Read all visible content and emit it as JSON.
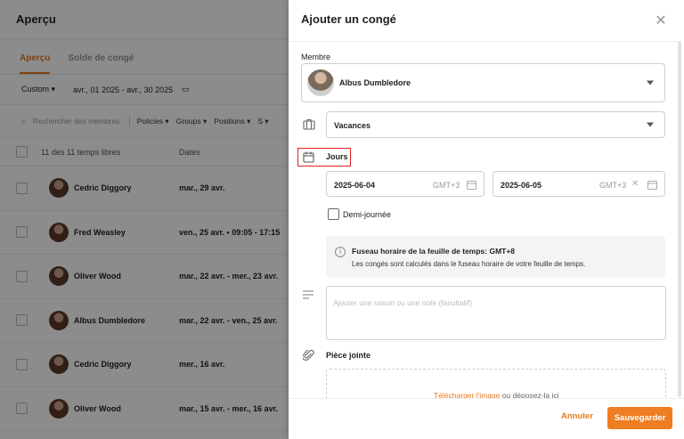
{
  "background": {
    "title": "Aperçu",
    "tabs": [
      {
        "label": "Aperçu",
        "active": true
      },
      {
        "label": "Solde de congé",
        "active": false
      }
    ],
    "range_label": "Custom",
    "date_range": "avr., 01 2025 - avr., 30 2025",
    "search_placeholder": "Rechercher des membres",
    "filters": [
      "Policies",
      "Groups",
      "Positions",
      "S"
    ],
    "count_text": "11 des 11 temps libres",
    "dates_header": "Dates",
    "rows": [
      {
        "name": "Cedric Diggory",
        "date": "mar., 29 avr."
      },
      {
        "name": "Fred Weasley",
        "date": "ven., 25 avr. • 09:05 - 17:15"
      },
      {
        "name": "Oliver Wood",
        "date": "mar., 22 avr. - mer., 23 avr."
      },
      {
        "name": "Albus Dumbledore",
        "date": "mar., 22 avr. - ven., 25 avr."
      },
      {
        "name": "Cedric Diggory",
        "date": "mer., 16 avr."
      },
      {
        "name": "Oliver Wood",
        "date": "mar., 15 avr. - mer., 16 avr."
      }
    ]
  },
  "panel": {
    "title": "Ajouter un congé",
    "member_label": "Membre",
    "member_name": "Albus Dumbledore",
    "leave_type": "Vacances",
    "days_label": "Jours",
    "start_date": "2025-06-04",
    "end_date": "2025-06-05",
    "timezone_short": "GMT+3",
    "half_day_label": "Demi-journée",
    "info_title": "Fuseau horaire de la feuille de temps: GMT+8",
    "info_text": "Les congés sont calculés dans le fuseau horaire de votre feuille de temps.",
    "note_placeholder": "Ajouter une raison ou une note (facultatif)",
    "attachment_label": "Pièce jointe",
    "upload_link": "Télécharger l'image",
    "upload_text": " ou déposez-la ici",
    "cancel_label": "Annuler",
    "save_label": "Sauvegarder"
  },
  "colors": {
    "accent": "#ef7d22",
    "highlight": "#e02020"
  }
}
